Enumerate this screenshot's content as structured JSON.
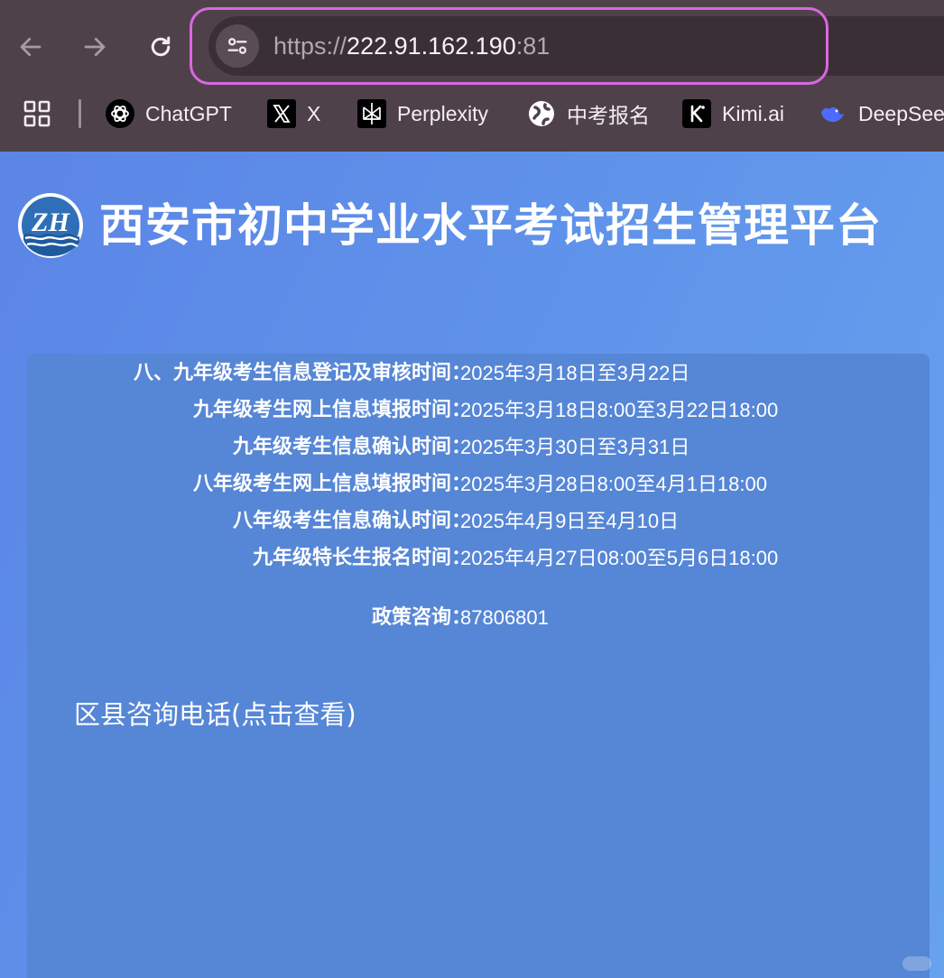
{
  "browser": {
    "url_scheme": "https://",
    "url_host": "222.91.162.190",
    "url_port": ":81",
    "bookmarks": [
      {
        "label": "ChatGPT",
        "icon": "chatgpt-icon"
      },
      {
        "label": "X",
        "icon": "x-icon"
      },
      {
        "label": "Perplexity",
        "icon": "perplexity-icon"
      },
      {
        "label": "中考报名",
        "icon": "globe-icon"
      },
      {
        "label": "Kimi.ai",
        "icon": "kimi-icon"
      },
      {
        "label": "DeepSee",
        "icon": "deepseek-icon"
      }
    ],
    "colors": {
      "highlight": "#d968e0",
      "toolbar": "#4f4149"
    }
  },
  "page": {
    "title": "西安市初中学业水平考试招生管理平台",
    "logo_letters": "ZH",
    "schedule": [
      {
        "label": "八、九年级考生信息登记及审核时间：",
        "value": "2025年3月18日至3月22日"
      },
      {
        "label": "九年级考生网上信息填报时间：",
        "value": "2025年3月18日8:00至3月22日18:00"
      },
      {
        "label": "九年级考生信息确认时间：",
        "value": "2025年3月30日至3月31日"
      },
      {
        "label": "八年级考生网上信息填报时间：",
        "value": "2025年3月28日8:00至4月1日18:00"
      },
      {
        "label": "八年级考生信息确认时间：",
        "value": "2025年4月9日至4月10日"
      },
      {
        "label": "九年级特长生报名时间：",
        "value": "2025年4月27日08:00至5月6日18:00"
      }
    ],
    "policy": {
      "label": "政策咨询：",
      "value": "87806801"
    },
    "district_link": "区县咨询电话(点击查看)",
    "colors": {
      "panel": "#5686d6",
      "background": "#5f92ea"
    }
  }
}
